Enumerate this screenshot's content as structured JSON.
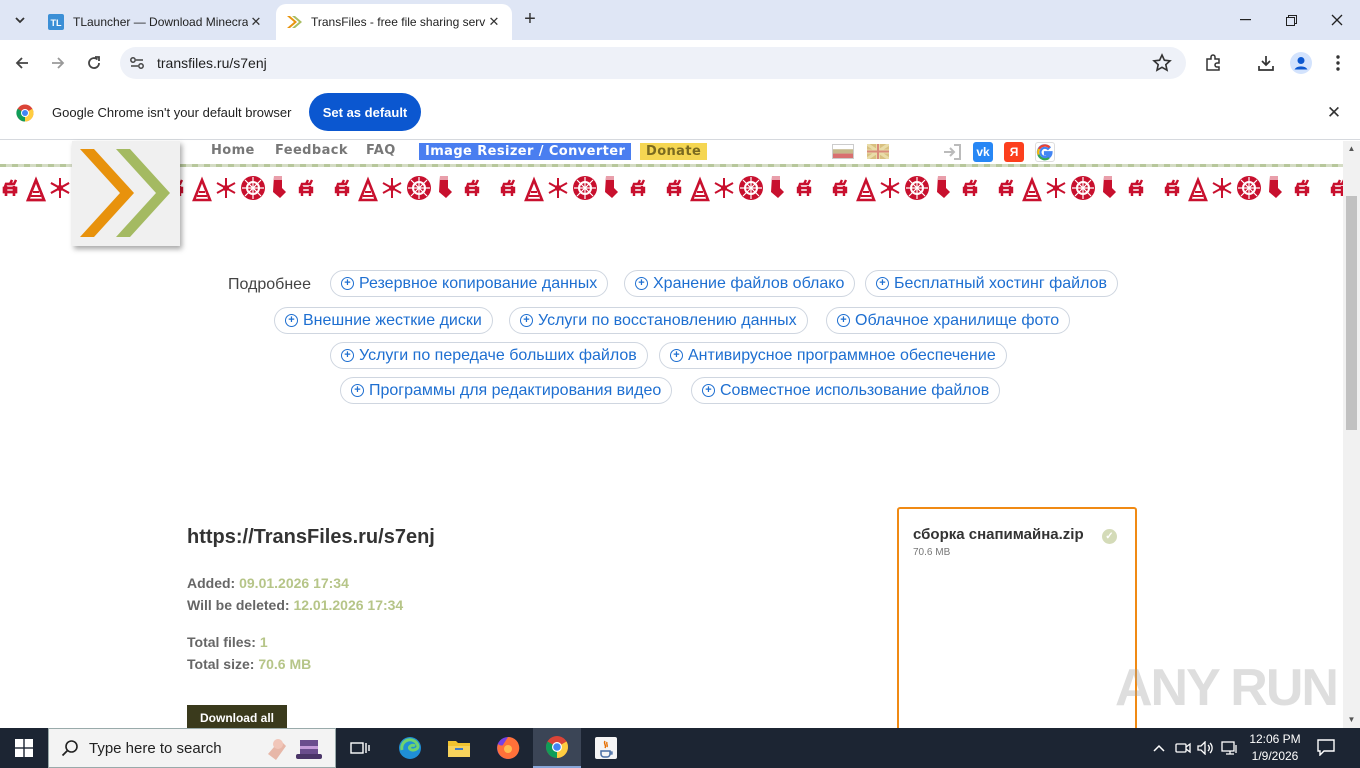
{
  "browser": {
    "tabs": [
      {
        "title": "TLauncher — Download Minecraft",
        "active": false,
        "favicon": "tlauncher-icon"
      },
      {
        "title": "TransFiles - free file sharing service",
        "active": true,
        "favicon": "transfiles-icon"
      }
    ],
    "url": "transfiles.ru/s7enj",
    "infobar": {
      "message": "Google Chrome isn't your default browser",
      "button": "Set as default"
    }
  },
  "site": {
    "nav": {
      "home": "Home",
      "feedback": "Feedback",
      "faq": "FAQ",
      "resizer": "Image Resizer / Converter",
      "donate": "Donate"
    },
    "social": {
      "vk": "vk",
      "yandex": "Я",
      "google": "G"
    },
    "tags_label": "Подробнее",
    "tags": [
      "Резервное копирование данных",
      "Хранение файлов облако",
      "Бесплатный хостинг файлов",
      "Внешние жесткие диски",
      "Услуги по восстановлению данных",
      "Облачное хранилище фото",
      "Услуги по передаче больших файлов",
      "Антивирусное программное обеспечение",
      "Программы для редактирования видео",
      "Совместное использование файлов"
    ],
    "share": {
      "url": "https://TransFiles.ru/s7enj",
      "added_label": "Added:",
      "added_value": "09.01.2026 17:34",
      "deleted_label": "Will be deleted:",
      "deleted_value": "12.01.2026 17:34",
      "files_label": "Total files:",
      "files_value": "1",
      "size_label": "Total size:",
      "size_value": "70.6 MB",
      "download_all": "Download all"
    },
    "file": {
      "name": "сборка снапимайна.zip",
      "size": "70.6 MB"
    },
    "watermark": "ANY RUN"
  },
  "taskbar": {
    "search_placeholder": "Type here to search",
    "time": "12:06 PM",
    "date": "1/9/2026"
  },
  "colors": {
    "accent_blue": "#0b57d0",
    "link_blue": "#1e6fd1",
    "card_border": "#f08a14",
    "meta_value": "#b6c588"
  }
}
